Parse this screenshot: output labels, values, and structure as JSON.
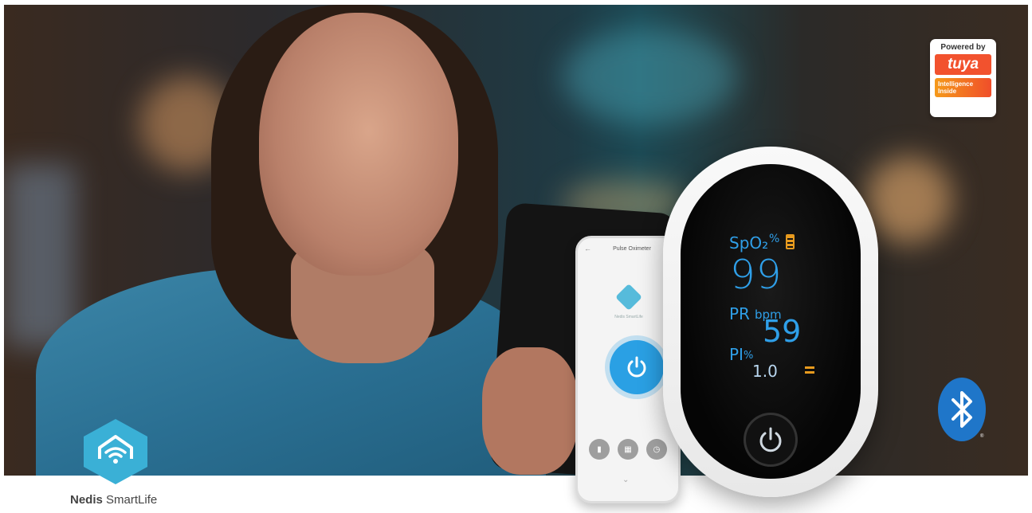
{
  "hero": {
    "scene": "woman-with-phone-background"
  },
  "app_screen": {
    "title": "Pulse Oximeter",
    "logo_text": "Nedis SmartLife",
    "icons": [
      "back-arrow-icon",
      "power-icon",
      "chart-icon",
      "calendar-icon",
      "clock-icon",
      "chevron-down-icon"
    ]
  },
  "oximeter": {
    "spo2_label": "SpO₂",
    "spo2_unit": "%",
    "spo2_value": "99",
    "pr_label": "PR",
    "pr_unit": "bpm",
    "pr_value": "59",
    "pi_label": "PI",
    "pi_unit": "%",
    "pi_value": "1.0",
    "accent_color": "#2f9fe8",
    "indicator_color": "#e79a1e"
  },
  "tuya_badge": {
    "top": "Powered by",
    "brand": "tuya",
    "bottom_line1": "Intelligence",
    "bottom_line2": "Inside"
  },
  "brand": {
    "name_bold": "Nedis",
    "name_light": "SmartLife",
    "color": "#3ab0d6"
  },
  "bluetooth": {
    "color": "#1f76c9",
    "mark": "®"
  }
}
